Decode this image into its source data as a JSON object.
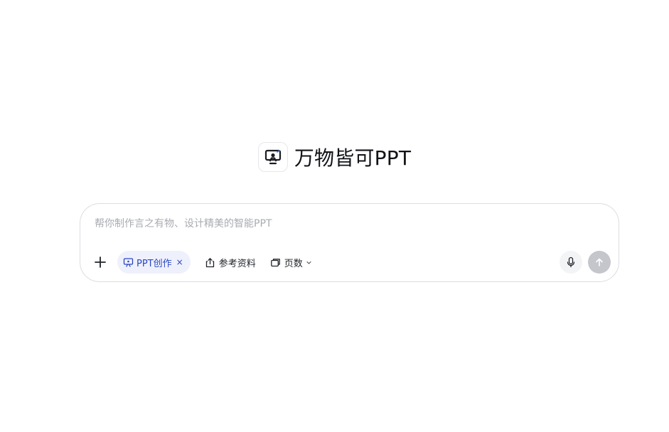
{
  "hero": {
    "title": "万物皆可PPT",
    "logo_icon": "presentation-person-icon"
  },
  "composer": {
    "placeholder": "帮你制作言之有物、设计精美的智能PPT",
    "value": "",
    "tools": {
      "add_icon": "plus-icon",
      "active_chip": {
        "label": "PPT创作",
        "icon": "presentation-icon",
        "close_symbol": "×"
      },
      "reference": {
        "label": "参考资料",
        "icon": "upload-icon"
      },
      "pages": {
        "label": "页数",
        "icon": "pages-icon",
        "caret_icon": "chevron-down-icon"
      }
    },
    "actions": {
      "mic_icon": "microphone-icon",
      "send_icon": "arrow-up-icon"
    }
  },
  "colors": {
    "accent": "#2c46c2",
    "chip_bg": "#eef1fb",
    "send_disabled": "#c4c6cb",
    "border": "#dcdde1",
    "placeholder": "#a9abb1"
  }
}
